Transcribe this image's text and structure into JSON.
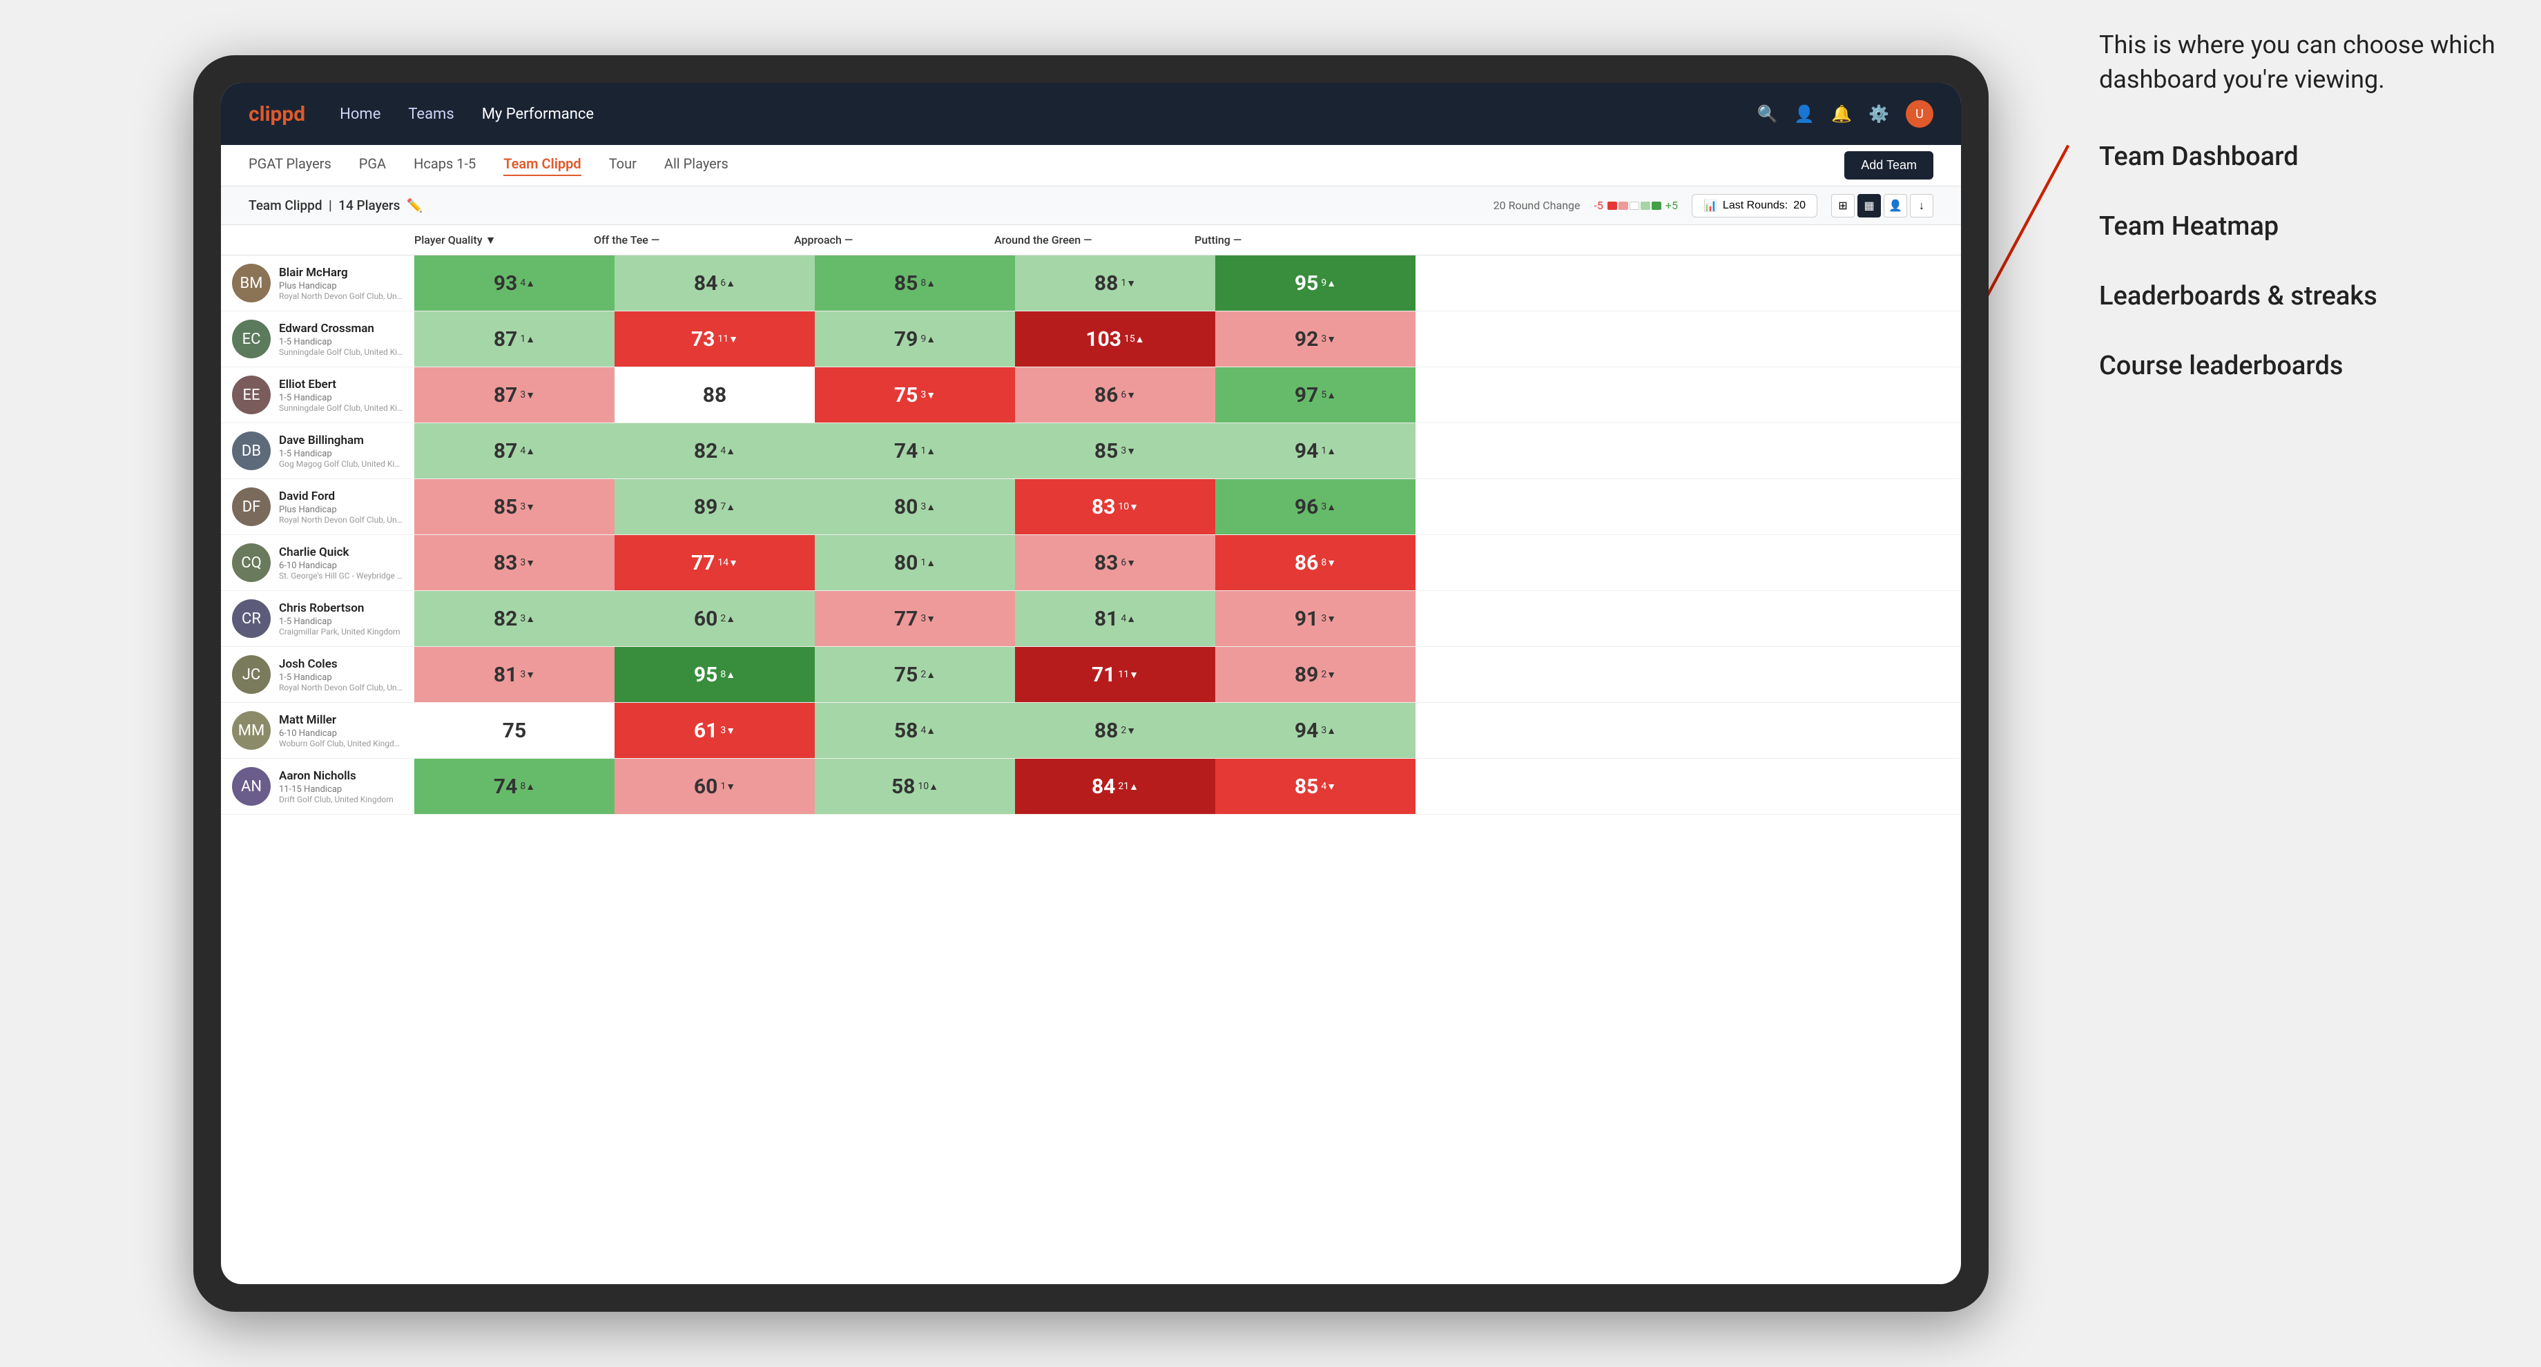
{
  "annotation": {
    "text": "This is where you can choose which dashboard you're viewing.",
    "items": [
      "Team Dashboard",
      "Team Heatmap",
      "Leaderboards & streaks",
      "Course leaderboards"
    ]
  },
  "nav": {
    "logo": "clippd",
    "links": [
      "Home",
      "Teams",
      "My Performance"
    ],
    "active_link": "My Performance"
  },
  "sub_nav": {
    "links": [
      "PGAT Players",
      "PGA",
      "Hcaps 1-5",
      "Team Clippd",
      "Tour",
      "All Players"
    ],
    "active_link": "Team Clippd",
    "add_team_label": "Add Team"
  },
  "team_header": {
    "title": "Team Clippd",
    "player_count": "14 Players",
    "round_change_label": "20 Round Change",
    "change_neg": "-5",
    "change_pos": "+5",
    "last_rounds_label": "Last Rounds:",
    "last_rounds_value": "20"
  },
  "col_headers": {
    "player_quality": "Player Quality",
    "off_the_tee": "Off the Tee",
    "approach": "Approach",
    "around_green": "Around the Green",
    "putting": "Putting"
  },
  "players": [
    {
      "name": "Blair McHarg",
      "handicap": "Plus Handicap",
      "club": "Royal North Devon Golf Club, United Kingdom",
      "avatar_color": "#8B7355",
      "initials": "BM",
      "stats": [
        {
          "value": "93",
          "change": "4",
          "dir": "up",
          "color": "green-mid"
        },
        {
          "value": "84",
          "change": "6",
          "dir": "up",
          "color": "green-light"
        },
        {
          "value": "85",
          "change": "8",
          "dir": "up",
          "color": "green-mid"
        },
        {
          "value": "88",
          "change": "1",
          "dir": "down",
          "color": "green-light"
        },
        {
          "value": "95",
          "change": "9",
          "dir": "up",
          "color": "green-dark"
        }
      ]
    },
    {
      "name": "Edward Crossman",
      "handicap": "1-5 Handicap",
      "club": "Sunningdale Golf Club, United Kingdom",
      "avatar_color": "#5C7A5C",
      "initials": "EC",
      "stats": [
        {
          "value": "87",
          "change": "1",
          "dir": "up",
          "color": "green-light"
        },
        {
          "value": "73",
          "change": "11",
          "dir": "down",
          "color": "red-mid"
        },
        {
          "value": "79",
          "change": "9",
          "dir": "up",
          "color": "green-light"
        },
        {
          "value": "103",
          "change": "15",
          "dir": "up",
          "color": "red-dark"
        },
        {
          "value": "92",
          "change": "3",
          "dir": "down",
          "color": "red-light"
        }
      ]
    },
    {
      "name": "Elliot Ebert",
      "handicap": "1-5 Handicap",
      "club": "Sunningdale Golf Club, United Kingdom",
      "avatar_color": "#7A5C5C",
      "initials": "EE",
      "stats": [
        {
          "value": "87",
          "change": "3",
          "dir": "down",
          "color": "red-light"
        },
        {
          "value": "88",
          "change": "",
          "dir": "",
          "color": "neutral"
        },
        {
          "value": "75",
          "change": "3",
          "dir": "down",
          "color": "red-mid"
        },
        {
          "value": "86",
          "change": "6",
          "dir": "down",
          "color": "red-light"
        },
        {
          "value": "97",
          "change": "5",
          "dir": "up",
          "color": "green-mid"
        }
      ]
    },
    {
      "name": "Dave Billingham",
      "handicap": "1-5 Handicap",
      "club": "Gog Magog Golf Club, United Kingdom",
      "avatar_color": "#5C6A7A",
      "initials": "DB",
      "stats": [
        {
          "value": "87",
          "change": "4",
          "dir": "up",
          "color": "green-light"
        },
        {
          "value": "82",
          "change": "4",
          "dir": "up",
          "color": "green-light"
        },
        {
          "value": "74",
          "change": "1",
          "dir": "up",
          "color": "green-light"
        },
        {
          "value": "85",
          "change": "3",
          "dir": "down",
          "color": "green-light"
        },
        {
          "value": "94",
          "change": "1",
          "dir": "up",
          "color": "green-light"
        }
      ]
    },
    {
      "name": "David Ford",
      "handicap": "Plus Handicap",
      "club": "Royal North Devon Golf Club, United Kingdom",
      "avatar_color": "#7A6A5C",
      "initials": "DF",
      "stats": [
        {
          "value": "85",
          "change": "3",
          "dir": "down",
          "color": "red-light"
        },
        {
          "value": "89",
          "change": "7",
          "dir": "up",
          "color": "green-light"
        },
        {
          "value": "80",
          "change": "3",
          "dir": "up",
          "color": "green-light"
        },
        {
          "value": "83",
          "change": "10",
          "dir": "down",
          "color": "red-mid"
        },
        {
          "value": "96",
          "change": "3",
          "dir": "up",
          "color": "green-mid"
        }
      ]
    },
    {
      "name": "Charlie Quick",
      "handicap": "6-10 Handicap",
      "club": "St. George's Hill GC - Weybridge - Surrey, Uni...",
      "avatar_color": "#6A7A5C",
      "initials": "CQ",
      "stats": [
        {
          "value": "83",
          "change": "3",
          "dir": "down",
          "color": "red-light"
        },
        {
          "value": "77",
          "change": "14",
          "dir": "down",
          "color": "red-mid"
        },
        {
          "value": "80",
          "change": "1",
          "dir": "up",
          "color": "green-light"
        },
        {
          "value": "83",
          "change": "6",
          "dir": "down",
          "color": "red-light"
        },
        {
          "value": "86",
          "change": "8",
          "dir": "down",
          "color": "red-mid"
        }
      ]
    },
    {
      "name": "Chris Robertson",
      "handicap": "1-5 Handicap",
      "club": "Craigmillar Park, United Kingdom",
      "avatar_color": "#5C5C7A",
      "initials": "CR",
      "stats": [
        {
          "value": "82",
          "change": "3",
          "dir": "up",
          "color": "green-light"
        },
        {
          "value": "60",
          "change": "2",
          "dir": "up",
          "color": "green-light"
        },
        {
          "value": "77",
          "change": "3",
          "dir": "down",
          "color": "red-light"
        },
        {
          "value": "81",
          "change": "4",
          "dir": "up",
          "color": "green-light"
        },
        {
          "value": "91",
          "change": "3",
          "dir": "down",
          "color": "red-light"
        }
      ]
    },
    {
      "name": "Josh Coles",
      "handicap": "1-5 Handicap",
      "club": "Royal North Devon Golf Club, United Kingdom",
      "avatar_color": "#7A7A5C",
      "initials": "JC",
      "stats": [
        {
          "value": "81",
          "change": "3",
          "dir": "down",
          "color": "red-light"
        },
        {
          "value": "95",
          "change": "8",
          "dir": "up",
          "color": "green-dark"
        },
        {
          "value": "75",
          "change": "2",
          "dir": "up",
          "color": "green-light"
        },
        {
          "value": "71",
          "change": "11",
          "dir": "down",
          "color": "red-dark"
        },
        {
          "value": "89",
          "change": "2",
          "dir": "down",
          "color": "red-light"
        }
      ]
    },
    {
      "name": "Matt Miller",
      "handicap": "6-10 Handicap",
      "club": "Woburn Golf Club, United Kingdom",
      "avatar_color": "#8B8B6A",
      "initials": "MM",
      "stats": [
        {
          "value": "75",
          "change": "",
          "dir": "",
          "color": "neutral"
        },
        {
          "value": "61",
          "change": "3",
          "dir": "down",
          "color": "red-mid"
        },
        {
          "value": "58",
          "change": "4",
          "dir": "up",
          "color": "green-light"
        },
        {
          "value": "88",
          "change": "2",
          "dir": "down",
          "color": "green-light"
        },
        {
          "value": "94",
          "change": "3",
          "dir": "up",
          "color": "green-light"
        }
      ]
    },
    {
      "name": "Aaron Nicholls",
      "handicap": "11-15 Handicap",
      "club": "Drift Golf Club, United Kingdom",
      "avatar_color": "#6A5C8B",
      "initials": "AN",
      "stats": [
        {
          "value": "74",
          "change": "8",
          "dir": "up",
          "color": "green-mid"
        },
        {
          "value": "60",
          "change": "1",
          "dir": "down",
          "color": "red-light"
        },
        {
          "value": "58",
          "change": "10",
          "dir": "up",
          "color": "green-light"
        },
        {
          "value": "84",
          "change": "21",
          "dir": "up",
          "color": "red-dark"
        },
        {
          "value": "85",
          "change": "4",
          "dir": "down",
          "color": "red-mid"
        }
      ]
    }
  ]
}
